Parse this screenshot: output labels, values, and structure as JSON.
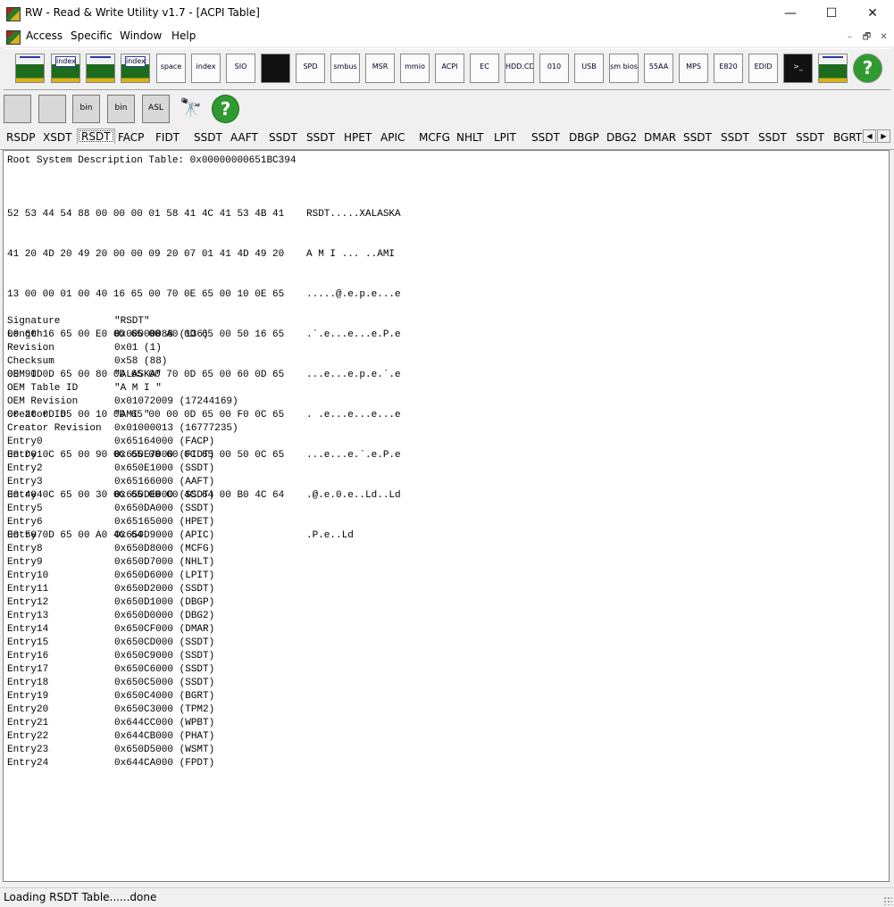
{
  "window": {
    "title": "RW - Read & Write Utility v1.7 - [ACPI Table]",
    "minimize": "—",
    "maximize": "☐",
    "close": "✕"
  },
  "menu": {
    "items": [
      "Access",
      "Specific",
      "Window",
      "Help"
    ],
    "mdi_minimize": "–",
    "mdi_restore": "🗗",
    "mdi_close": "✕"
  },
  "toolbar": {
    "icons": [
      {
        "name": "pci-icon",
        "label": ""
      },
      {
        "name": "pci-index-icon",
        "label": "index"
      },
      {
        "name": "memory-icon",
        "label": ""
      },
      {
        "name": "memory-index-icon",
        "label": "index"
      },
      {
        "name": "io-space-icon",
        "label": "space"
      },
      {
        "name": "io-index-icon",
        "label": "index"
      },
      {
        "name": "superio-icon",
        "label": "SIO"
      },
      {
        "name": "oscilloscope-icon",
        "label": ""
      },
      {
        "name": "spd-icon",
        "label": "SPD"
      },
      {
        "name": "smbus-icon",
        "label": "smbus"
      },
      {
        "name": "msr-icon",
        "label": "MSR"
      },
      {
        "name": "mmio-icon",
        "label": "mmio"
      },
      {
        "name": "acpi-icon",
        "label": "ACPI"
      },
      {
        "name": "ec-icon",
        "label": "EC"
      },
      {
        "name": "hdd-cd-icon",
        "label": "HDD.CD"
      },
      {
        "name": "disk-010-icon",
        "label": "010"
      },
      {
        "name": "usb-icon",
        "label": "USB"
      },
      {
        "name": "smbios-icon",
        "label": "sm bios"
      },
      {
        "name": "55aa-icon",
        "label": "55AA"
      },
      {
        "name": "mps-icon",
        "label": "MPS"
      },
      {
        "name": "e820-icon",
        "label": "E820"
      },
      {
        "name": "edid-icon",
        "label": "EDID"
      },
      {
        "name": "command-window-icon",
        "label": ">_"
      },
      {
        "name": "battery-icon",
        "label": ""
      },
      {
        "name": "help-icon",
        "label": "?"
      }
    ]
  },
  "toolbar2": {
    "icons": [
      {
        "name": "save-icon",
        "label": ""
      },
      {
        "name": "save-all-icon",
        "label": ""
      },
      {
        "name": "save-bin-icon",
        "label": "bin"
      },
      {
        "name": "save-all-bin-icon",
        "label": "bin"
      },
      {
        "name": "asl-icon",
        "label": "ASL"
      },
      {
        "name": "find-icon",
        "label": "🔭"
      },
      {
        "name": "help-icon",
        "label": "?"
      }
    ]
  },
  "tabs": [
    "RSDP",
    "XSDT",
    "RSDT",
    "FACP",
    "FIDT",
    "SSDT",
    "AAFT",
    "SSDT",
    "SSDT",
    "HPET",
    "APIC",
    "MCFG",
    "NHLT",
    "LPIT",
    "SSDT",
    "DBGP",
    "DBG2",
    "DMAR",
    "SSDT",
    "SSDT",
    "SSDT",
    "SSDT",
    "BGRT"
  ],
  "active_tab": "RSDT",
  "tab_scroll": {
    "left": "◀",
    "right": "▶"
  },
  "content": {
    "header": "Root System Description Table: 0x00000000651BC394",
    "hex": [
      "52 53 44 54 88 00 00 00 01 58 41 4C 41 53 4B 41",
      "41 20 4D 20 49 20 00 00 09 20 07 01 41 4D 49 20",
      "13 00 00 01 00 40 16 65 00 70 0E 65 00 10 0E 65",
      "00 60 16 65 00 E0 0D 65 00 A0 0D 65 00 50 16 65",
      "00 90 0D 65 00 80 0D 65 00 70 0D 65 00 60 0D 65",
      "00 20 0D 65 00 10 0D 65 00 00 0D 65 00 F0 0C 65",
      "00 D0 0C 65 00 90 0C 65 00 60 0C 65 00 50 0C 65",
      "00 40 0C 65 00 30 0C 65 00 C0 4C 64 00 B0 4C 64",
      "00 50 0D 65 00 A0 4C 64"
    ],
    "ascii": [
      "RSDT.....XALASKA",
      "A M I ... ..AMI",
      ".....@.e.p.e...e",
      ".`.e...e...e.P.e",
      "...e...e.p.e.`.e",
      ". .e...e...e...e",
      "...e...e.`.e.P.e",
      ".@.e.0.e..Ld..Ld",
      ".P.e..Ld"
    ],
    "fields": [
      [
        "Signature",
        "\"RSDT\""
      ],
      [
        "Length",
        "0x00000088 (136)"
      ],
      [
        "Revision",
        "0x01 (1)"
      ],
      [
        "Checksum",
        "0x58 (88)"
      ],
      [
        "OEM ID",
        "\"ALASKA\""
      ],
      [
        "OEM Table ID",
        "\"A M I \""
      ],
      [
        "OEM Revision",
        "0x01072009 (17244169)"
      ],
      [
        "Creator ID",
        "\"AMI \""
      ],
      [
        "Creator Revision",
        "0x01000013 (16777235)"
      ],
      [
        "Entry0",
        "0x65164000 (FACP)"
      ],
      [
        "Entry1",
        "0x650E7000 (FIDT)"
      ],
      [
        "Entry2",
        "0x650E1000 (SSDT)"
      ],
      [
        "Entry3",
        "0x65166000 (AAFT)"
      ],
      [
        "Entry4",
        "0x650DE000 (SSDT)"
      ],
      [
        "Entry5",
        "0x650DA000 (SSDT)"
      ],
      [
        "Entry6",
        "0x65165000 (HPET)"
      ],
      [
        "Entry7",
        "0x650D9000 (APIC)"
      ],
      [
        "Entry8",
        "0x650D8000 (MCFG)"
      ],
      [
        "Entry9",
        "0x650D7000 (NHLT)"
      ],
      [
        "Entry10",
        "0x650D6000 (LPIT)"
      ],
      [
        "Entry11",
        "0x650D2000 (SSDT)"
      ],
      [
        "Entry12",
        "0x650D1000 (DBGP)"
      ],
      [
        "Entry13",
        "0x650D0000 (DBG2)"
      ],
      [
        "Entry14",
        "0x650CF000 (DMAR)"
      ],
      [
        "Entry15",
        "0x650CD000 (SSDT)"
      ],
      [
        "Entry16",
        "0x650C9000 (SSDT)"
      ],
      [
        "Entry17",
        "0x650C6000 (SSDT)"
      ],
      [
        "Entry18",
        "0x650C5000 (SSDT)"
      ],
      [
        "Entry19",
        "0x650C4000 (BGRT)"
      ],
      [
        "Entry20",
        "0x650C3000 (TPM2)"
      ],
      [
        "Entry21",
        "0x644CC000 (WPBT)"
      ],
      [
        "Entry22",
        "0x644CB000 (PHAT)"
      ],
      [
        "Entry23",
        "0x650D5000 (WSMT)"
      ],
      [
        "Entry24",
        "0x644CA000 (FPDT)"
      ]
    ]
  },
  "status": "Loading RSDT Table......done"
}
